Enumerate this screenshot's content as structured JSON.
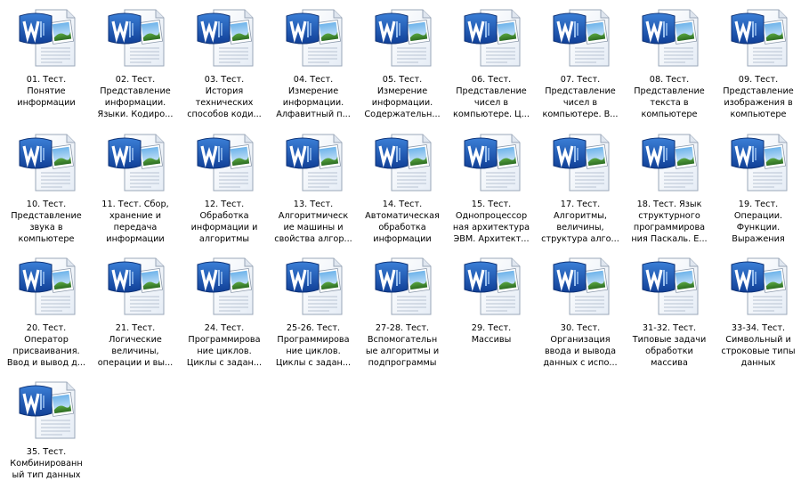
{
  "folder": {
    "files": [
      {
        "name": "01. Тест.\nПонятие\nинформации",
        "icon": "word-document-icon"
      },
      {
        "name": "02. Тест.\nПредставление\nинформации.\nЯзыки. Кодиро...",
        "icon": "word-document-icon"
      },
      {
        "name": "03. Тест.\nИстория\nтехнических\nспособов коди...",
        "icon": "word-document-icon"
      },
      {
        "name": "04. Тест.\nИзмерение\nинформации.\nАлфавитный п...",
        "icon": "word-document-icon"
      },
      {
        "name": "05. Тест.\nИзмерение\nинформации.\nСодержательн...",
        "icon": "word-document-icon"
      },
      {
        "name": "06. Тест.\nПредставление\nчисел в\nкомпьютере. Ц...",
        "icon": "word-document-icon"
      },
      {
        "name": "07. Тест.\nПредставление\nчисел в\nкомпьютере. В...",
        "icon": "word-document-icon"
      },
      {
        "name": "08. Тест.\nПредставление\nтекста в\nкомпьютере",
        "icon": "word-document-icon"
      },
      {
        "name": "09. Тест.\nПредставление\nизображения в\nкомпьютере",
        "icon": "word-document-icon"
      },
      {
        "name": "10. Тест.\nПредставление\nзвука в\nкомпьютере",
        "icon": "word-document-icon"
      },
      {
        "name": "11. Тест. Сбор,\nхранение и\nпередача\nинформации",
        "icon": "word-document-icon"
      },
      {
        "name": "12. Тест.\nОбработка\nинформации и\nалгоритмы",
        "icon": "word-document-icon"
      },
      {
        "name": "13. Тест.\nАлгоритмическ\nие машины и\nсвойства алгор...",
        "icon": "word-document-icon"
      },
      {
        "name": "14. Тест.\nАвтоматическая\nобработка\nинформации",
        "icon": "word-document-icon"
      },
      {
        "name": "15. Тест.\nОднопроцессор\nная архитектура\nЭВМ. Архитект...",
        "icon": "word-document-icon"
      },
      {
        "name": "17. Тест.\nАлгоритмы,\nвеличины,\nструктура алго...",
        "icon": "word-document-icon"
      },
      {
        "name": "18. Тест. Язык\nструктурного\nпрограммирова\nния Паскаль. Е...",
        "icon": "word-document-icon"
      },
      {
        "name": "19. Тест.\nОперации.\nФункции.\nВыражения",
        "icon": "word-document-icon"
      },
      {
        "name": "20. Тест.\nОператор\nприсваивания.\nВвод и вывод д...",
        "icon": "word-document-icon"
      },
      {
        "name": "21. Тест.\nЛогические\nвеличины,\nоперации и вы...",
        "icon": "word-document-icon"
      },
      {
        "name": "24. Тест.\nПрограммирова\nние циклов.\nЦиклы с задан...",
        "icon": "word-document-icon"
      },
      {
        "name": "25-26. Тест.\nПрограммирова\nние циклов.\nЦиклы с задан...",
        "icon": "word-document-icon"
      },
      {
        "name": "27-28. Тест.\nВспомогательн\nые алгоритмы и\nподпрограммы",
        "icon": "word-document-icon"
      },
      {
        "name": "29. Тест.\nМассивы",
        "icon": "word-document-icon"
      },
      {
        "name": "30. Тест.\nОрганизация\nввода и вывода\nданных с испо...",
        "icon": "word-document-icon"
      },
      {
        "name": "31-32. Тест.\nТиповые задачи\nобработки\nмассива",
        "icon": "word-document-icon"
      },
      {
        "name": "33-34. Тест.\nСимвольный и\nстроковые типы\nданных",
        "icon": "word-document-icon"
      },
      {
        "name": "35. Тест.\nКомбинированн\nый тип данных",
        "icon": "word-document-icon"
      }
    ]
  }
}
